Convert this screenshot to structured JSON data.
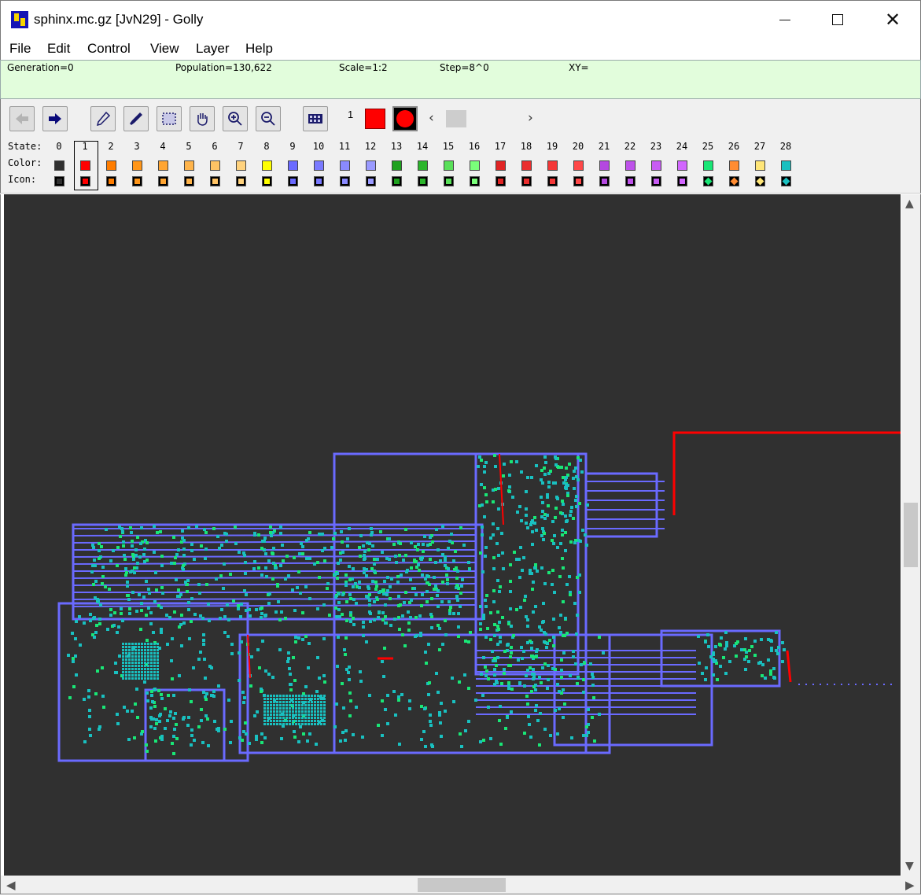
{
  "window": {
    "title": "sphinx.mc.gz [JvN29] - Golly",
    "icon": "golly-app-icon"
  },
  "menu": [
    "File",
    "Edit",
    "Control",
    "View",
    "Layer",
    "Help"
  ],
  "status": {
    "generation": "Generation=0",
    "population": "Population=130,622",
    "scale": "Scale=1:2",
    "step": "Step=8^0",
    "xy": "XY="
  },
  "toolbar": {
    "buttons": [
      "back-arrow-icon",
      "forward-arrow-icon",
      "pencil-icon",
      "eyedropper-icon",
      "select-icon",
      "hand-icon",
      "zoom-in-icon",
      "zoom-out-icon",
      "grid-icon"
    ],
    "current_state": "1",
    "current_color": "#ff0000"
  },
  "palette": {
    "state_label": "State:",
    "color_label": "Color:",
    "icon_label": "Icon:",
    "selected_state": 1,
    "states": [
      "0",
      "1",
      "2",
      "3",
      "4",
      "5",
      "6",
      "7",
      "8",
      "9",
      "10",
      "11",
      "12",
      "13",
      "14",
      "15",
      "16",
      "17",
      "18",
      "19",
      "20",
      "21",
      "22",
      "23",
      "24",
      "25",
      "26",
      "27",
      "28"
    ],
    "colors": [
      "#303030",
      "#ff0000",
      "#ff7d00",
      "#ff9619",
      "#ffa532",
      "#ffb44b",
      "#ffc364",
      "#ffd27d",
      "#ffff00",
      "#6a6aff",
      "#7a7aff",
      "#8a8aff",
      "#9a9aff",
      "#1ea11e",
      "#2cb52c",
      "#59e059",
      "#7aff7a",
      "#e02424",
      "#ea2e2e",
      "#f43838",
      "#ff4848",
      "#b448e0",
      "#be52ea",
      "#c85cf4",
      "#d266ff",
      "#19e676",
      "#ff8c32",
      "#ffe678",
      "#19c0c0"
    ]
  },
  "canvas": {
    "background": "#303030",
    "wire_color": "#6a6aff",
    "cell_color": "#19c0c0",
    "signal_color": "#ff0000"
  }
}
